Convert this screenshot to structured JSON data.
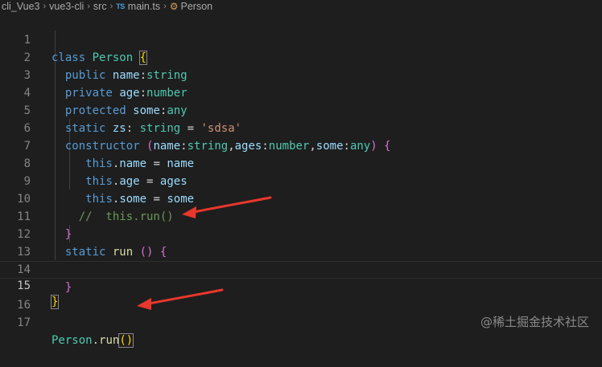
{
  "breadcrumb": {
    "items": [
      "cli_Vue3",
      "vue3-cli",
      "src",
      "main.ts",
      "Person"
    ],
    "file_icon": "TS",
    "symbol_icon": "class-symbol-icon"
  },
  "editor": {
    "line_numbers": [
      "1",
      "2",
      "3",
      "4",
      "5",
      "6",
      "7",
      "8",
      "9",
      "10",
      "11",
      "12",
      "13",
      "14",
      "15",
      "16",
      "17"
    ],
    "current_line": "15"
  },
  "watermark": "@稀土掘金技术社区",
  "colors": {
    "background": "#1e1e1e",
    "keyword": "#569cd6",
    "property": "#9cdcfe",
    "type": "#4ec9b0",
    "string": "#ce9178",
    "comment": "#6a9955",
    "arrow": "#e8372c"
  },
  "annotations": {
    "arrows": [
      "red-arrow-static-run",
      "red-arrow-person-run"
    ]
  }
}
